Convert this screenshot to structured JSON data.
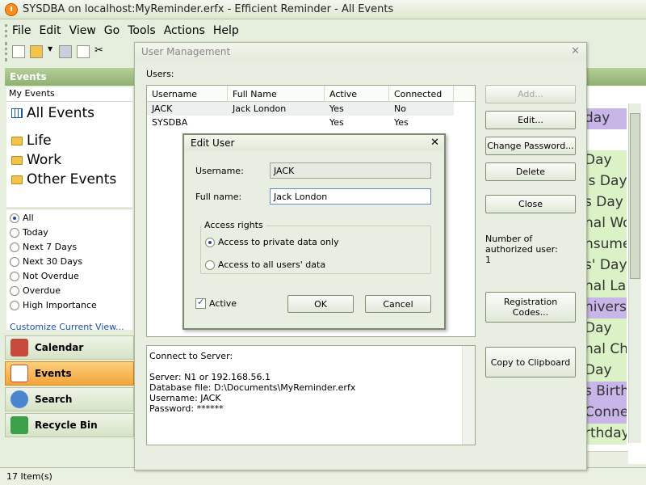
{
  "window": {
    "title": "SYSDBA on localhost:MyReminder.erfx - Efficient Reminder - All Events"
  },
  "menu": [
    "File",
    "Edit",
    "View",
    "Go",
    "Tools",
    "Actions",
    "Help"
  ],
  "left": {
    "header": "Events",
    "my_events": "My Events",
    "tree": [
      "All Events",
      "Life",
      "Work",
      "Other Events"
    ],
    "filters": [
      "All",
      "Today",
      "Next 7 Days",
      "Next 30 Days",
      "Not Overdue",
      "Overdue",
      "High Importance"
    ],
    "customize": "Customize Current View...",
    "nav": [
      "Calendar",
      "Events",
      "Search",
      "Recycle Bin"
    ]
  },
  "status": "17 Item(s)",
  "background_rows": [
    "day",
    "Day",
    "'s Day",
    "s Day",
    "nal Wo",
    "nsume",
    "s' Day",
    "nal Lab",
    "niversa",
    "Day",
    "nal Ch",
    "Day",
    "s Birth",
    "Connel",
    "rthday"
  ],
  "user_mgmt": {
    "title": "User Management",
    "users_label": "Users:",
    "columns": [
      "Username",
      "Full Name",
      "Active",
      "Connected"
    ],
    "rows": [
      {
        "username": "JACK",
        "full_name": "Jack London",
        "active": "Yes",
        "connected": "No"
      },
      {
        "username": "SYSDBA",
        "full_name": "",
        "active": "Yes",
        "connected": "Yes"
      }
    ],
    "buttons": {
      "add": "Add...",
      "edit": "Edit...",
      "change_password": "Change Password...",
      "delete": "Delete",
      "close": "Close",
      "registration": "Registration Codes...",
      "copy": "Copy to Clipboard"
    },
    "auth_label": "Number of authorized user:",
    "auth_count": "1",
    "connect_title": "Connect to Server:",
    "connect_lines": [
      "Server: N1 or 192.168.56.1",
      "Database file: D:\\Documents\\MyReminder.erfx",
      "Username: JACK",
      "Password: ******"
    ]
  },
  "edit_user": {
    "title": "Edit User",
    "username_label": "Username:",
    "username_value": "JACK",
    "fullname_label": "Full name:",
    "fullname_value": "Jack London",
    "access_legend": "Access rights",
    "opt_private": "Access to private data only",
    "opt_all": "Access to all users' data",
    "active_label": "Active",
    "ok": "OK",
    "cancel": "Cancel"
  },
  "colors": {
    "accent_orange": "#f3a43a",
    "header_green": "#8fb06f",
    "row_purple": "#c9b6e8",
    "row_green": "#daf2c5"
  }
}
